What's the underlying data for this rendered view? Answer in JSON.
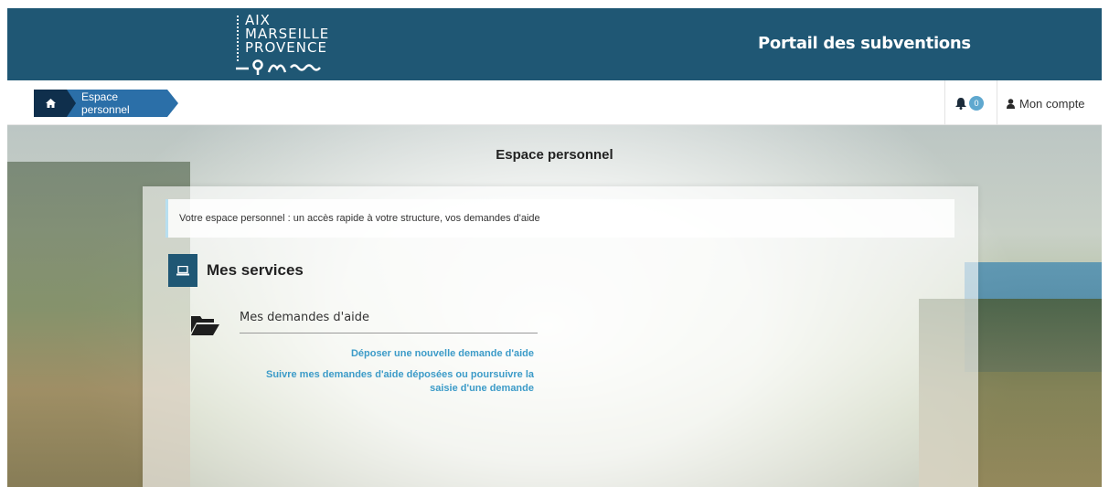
{
  "header": {
    "logo_lines": [
      "AIX",
      "MARSEILLE",
      "PROVENCE"
    ],
    "portal_title": "Portail des subventions"
  },
  "breadcrumb": {
    "home_icon": "home-icon",
    "current": "Espace personnel"
  },
  "notifications": {
    "icon": "bell-icon",
    "count": "0"
  },
  "account": {
    "icon": "user-icon",
    "label": "Mon compte"
  },
  "page": {
    "title": "Espace personnel",
    "intro": "Votre espace personnel : un accès rapide à votre structure, vos demandes d'aide"
  },
  "services": {
    "title": "Mes services",
    "icon": "laptop-icon",
    "demandes": {
      "icon": "folder-open-icon",
      "title": "Mes demandes d'aide",
      "link_new": "Déposer une nouvelle demande d'aide",
      "link_follow": "Suivre mes demandes d'aide déposées ou poursuivre la saisie d'une demande"
    }
  },
  "colors": {
    "header_bg": "#1f5774",
    "breadcrumb_home": "#0f2f4c",
    "breadcrumb_active": "#2b6fa8",
    "link": "#3c9bc8",
    "badge": "#5fa8cf"
  }
}
